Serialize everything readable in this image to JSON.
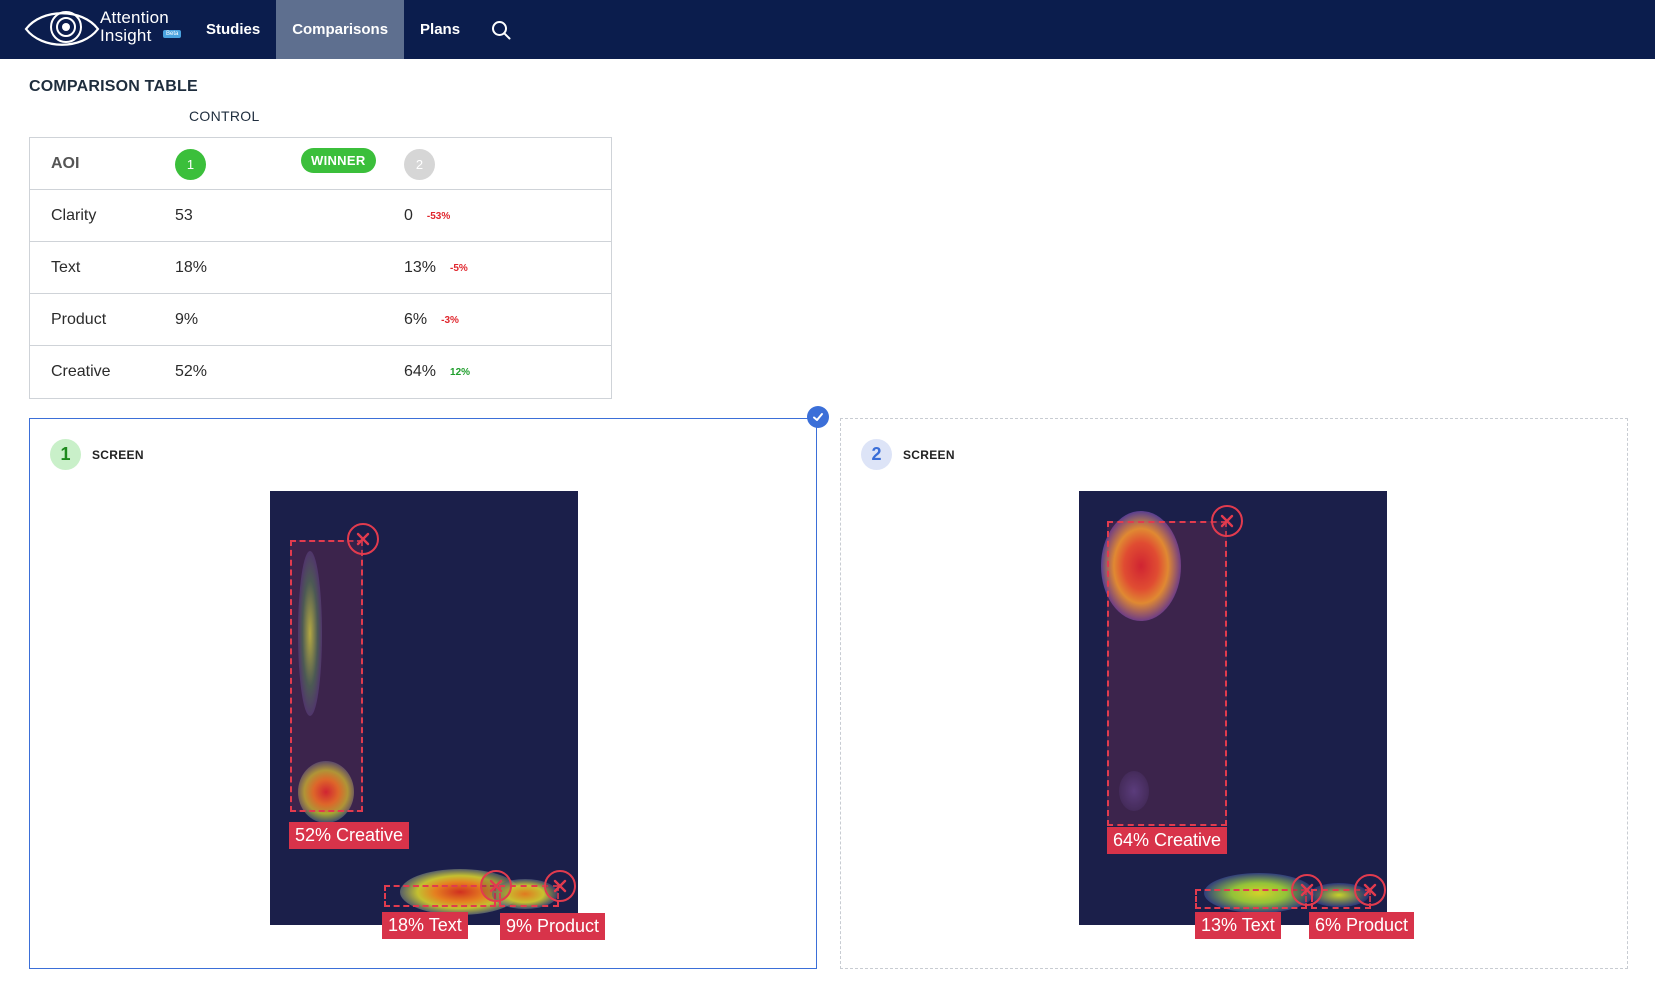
{
  "nav": {
    "brand_line1": "Attention",
    "brand_line2": "Insight",
    "beta": "Beta",
    "items": [
      "Studies",
      "Comparisons",
      "Plans"
    ],
    "active": "Comparisons",
    "search_icon": "search-icon"
  },
  "page": {
    "title": "COMPARISON TABLE",
    "control_label": "CONTROL"
  },
  "table": {
    "header": {
      "aoi": "AOI",
      "variant1": "1",
      "winner": "WINNER",
      "variant2": "2"
    },
    "rows": [
      {
        "aoi": "Clarity",
        "v1": "53",
        "v2": "0",
        "delta": "-53%",
        "delta_type": "neg"
      },
      {
        "aoi": "Text",
        "v1": "18%",
        "v2": "13%",
        "delta": "-5%",
        "delta_type": "neg"
      },
      {
        "aoi": "Product",
        "v1": "9%",
        "v2": "6%",
        "delta": "-3%",
        "delta_type": "neg"
      },
      {
        "aoi": "Creative",
        "v1": "52%",
        "v2": "64%",
        "delta": "12%",
        "delta_type": "pos"
      }
    ]
  },
  "screens": [
    {
      "number": "1",
      "title": "SCREEN",
      "selected": true,
      "labels": {
        "creative": "52% Creative",
        "text": "18% Text",
        "product": "9% Product"
      }
    },
    {
      "number": "2",
      "title": "SCREEN",
      "selected": false,
      "labels": {
        "creative": "64% Creative",
        "text": "13% Text",
        "product": "6% Product"
      }
    }
  ],
  "colors": {
    "navbar": "#0b1d4d",
    "active_nav": "#5e6f8f",
    "winner_green": "#3bbf3b",
    "negative": "#e0262d",
    "positive": "#1f9e2c",
    "aoi_red": "#d8334a",
    "selected_border": "#3b6fd8",
    "screenshot_bg": "#1b1f4a"
  }
}
